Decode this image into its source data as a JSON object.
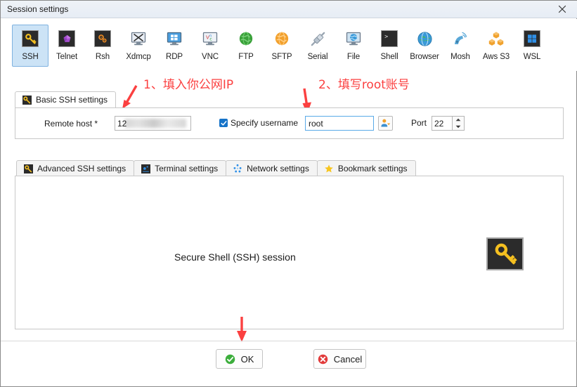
{
  "window": {
    "title": "Session settings",
    "close_label": "✕"
  },
  "protocols": [
    {
      "label": "SSH",
      "icon": "ssh-key-icon",
      "selected": true
    },
    {
      "label": "Telnet",
      "icon": "telnet-icon",
      "selected": false
    },
    {
      "label": "Rsh",
      "icon": "rsh-gears-icon",
      "selected": false
    },
    {
      "label": "Xdmcp",
      "icon": "xdmcp-icon",
      "selected": false
    },
    {
      "label": "RDP",
      "icon": "rdp-monitor-icon",
      "selected": false
    },
    {
      "label": "VNC",
      "icon": "vnc-monitor-icon",
      "selected": false
    },
    {
      "label": "FTP",
      "icon": "ftp-globe-icon",
      "selected": false
    },
    {
      "label": "SFTP",
      "icon": "sftp-globe-icon",
      "selected": false
    },
    {
      "label": "Serial",
      "icon": "serial-plug-icon",
      "selected": false
    },
    {
      "label": "File",
      "icon": "file-monitor-icon",
      "selected": false
    },
    {
      "label": "Shell",
      "icon": "shell-prompt-icon",
      "selected": false
    },
    {
      "label": "Browser",
      "icon": "browser-globe-icon",
      "selected": false
    },
    {
      "label": "Mosh",
      "icon": "mosh-dish-icon",
      "selected": false
    },
    {
      "label": "Aws S3",
      "icon": "aws-s3-icon",
      "selected": false
    },
    {
      "label": "WSL",
      "icon": "wsl-windows-icon",
      "selected": false
    }
  ],
  "annotations": [
    {
      "text": "1、填入你公网IP",
      "color": "#fb4040"
    },
    {
      "text": "2、填写root账号",
      "color": "#fb4040"
    }
  ],
  "basic_tab": {
    "label": "Basic SSH settings",
    "icon": "ssh-key-icon"
  },
  "form": {
    "remote_host_label": "Remote host *",
    "remote_host_value": "12",
    "remote_host_redacted": true,
    "specify_username_label": "Specify username",
    "specify_username_checked": true,
    "username_value": "root",
    "user_picker_icon": "user-select-icon",
    "port_label": "Port",
    "port_value": "22"
  },
  "sub_tabs": [
    {
      "label": "Advanced SSH settings",
      "icon": "ssh-key-icon",
      "active": false
    },
    {
      "label": "Terminal settings",
      "icon": "terminal-icon",
      "active": false
    },
    {
      "label": "Network settings",
      "icon": "network-dots-icon",
      "active": false
    },
    {
      "label": "Bookmark settings",
      "icon": "star-icon",
      "active": false
    }
  ],
  "content": {
    "session_description": "Secure Shell (SSH) session",
    "session_icon": "ssh-key-icon"
  },
  "footer": {
    "ok_label": "OK",
    "cancel_label": "Cancel",
    "ok_icon": "check-circle-icon",
    "cancel_icon": "x-circle-icon"
  },
  "colors": {
    "accent_selection": "#cce3f6",
    "accent_border": "#7fb2e0",
    "annotation_red": "#fb4040",
    "ok_green": "#3cae3c",
    "cancel_red": "#e23b3b",
    "key_yellow": "#f5c020"
  }
}
